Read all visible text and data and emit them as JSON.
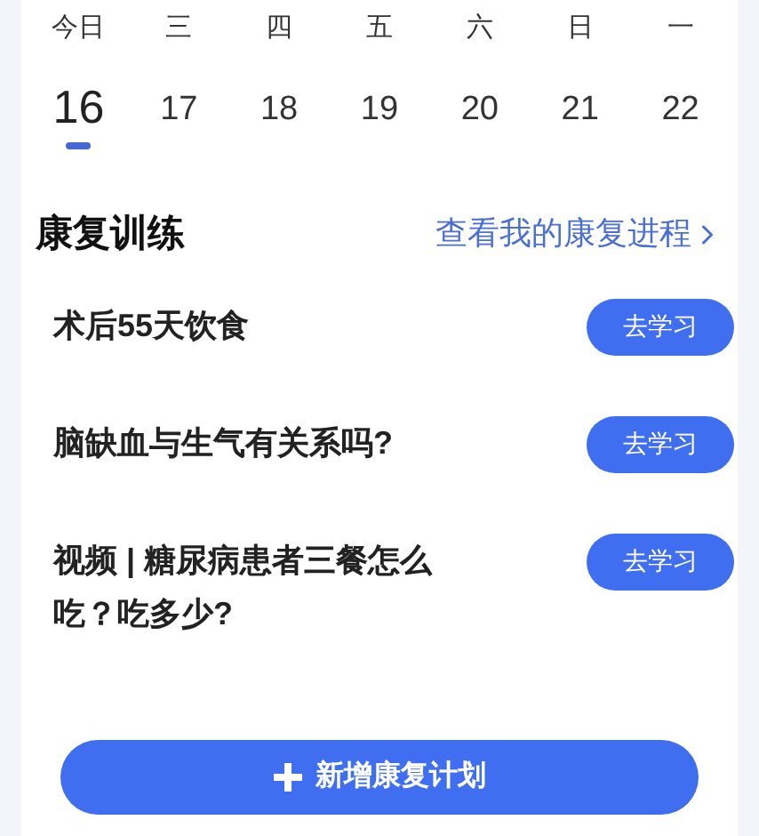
{
  "week": [
    {
      "weekday": "今日",
      "date": "16",
      "selected": true
    },
    {
      "weekday": "三",
      "date": "17",
      "selected": false
    },
    {
      "weekday": "四",
      "date": "18",
      "selected": false
    },
    {
      "weekday": "五",
      "date": "19",
      "selected": false
    },
    {
      "weekday": "六",
      "date": "20",
      "selected": false
    },
    {
      "weekday": "日",
      "date": "21",
      "selected": false
    },
    {
      "weekday": "一",
      "date": "22",
      "selected": false
    }
  ],
  "section": {
    "title": "康复训练",
    "link": "查看我的康复进程"
  },
  "lessons": [
    {
      "title": "术后55天饮食",
      "action": "去学习"
    },
    {
      "title": "脑缺血与生气有关系吗?",
      "action": "去学习"
    },
    {
      "title": "视频 | 糖尿病患者三餐怎么吃？吃多少?",
      "action": "去学习"
    }
  ],
  "add_button": "新增康复计划"
}
